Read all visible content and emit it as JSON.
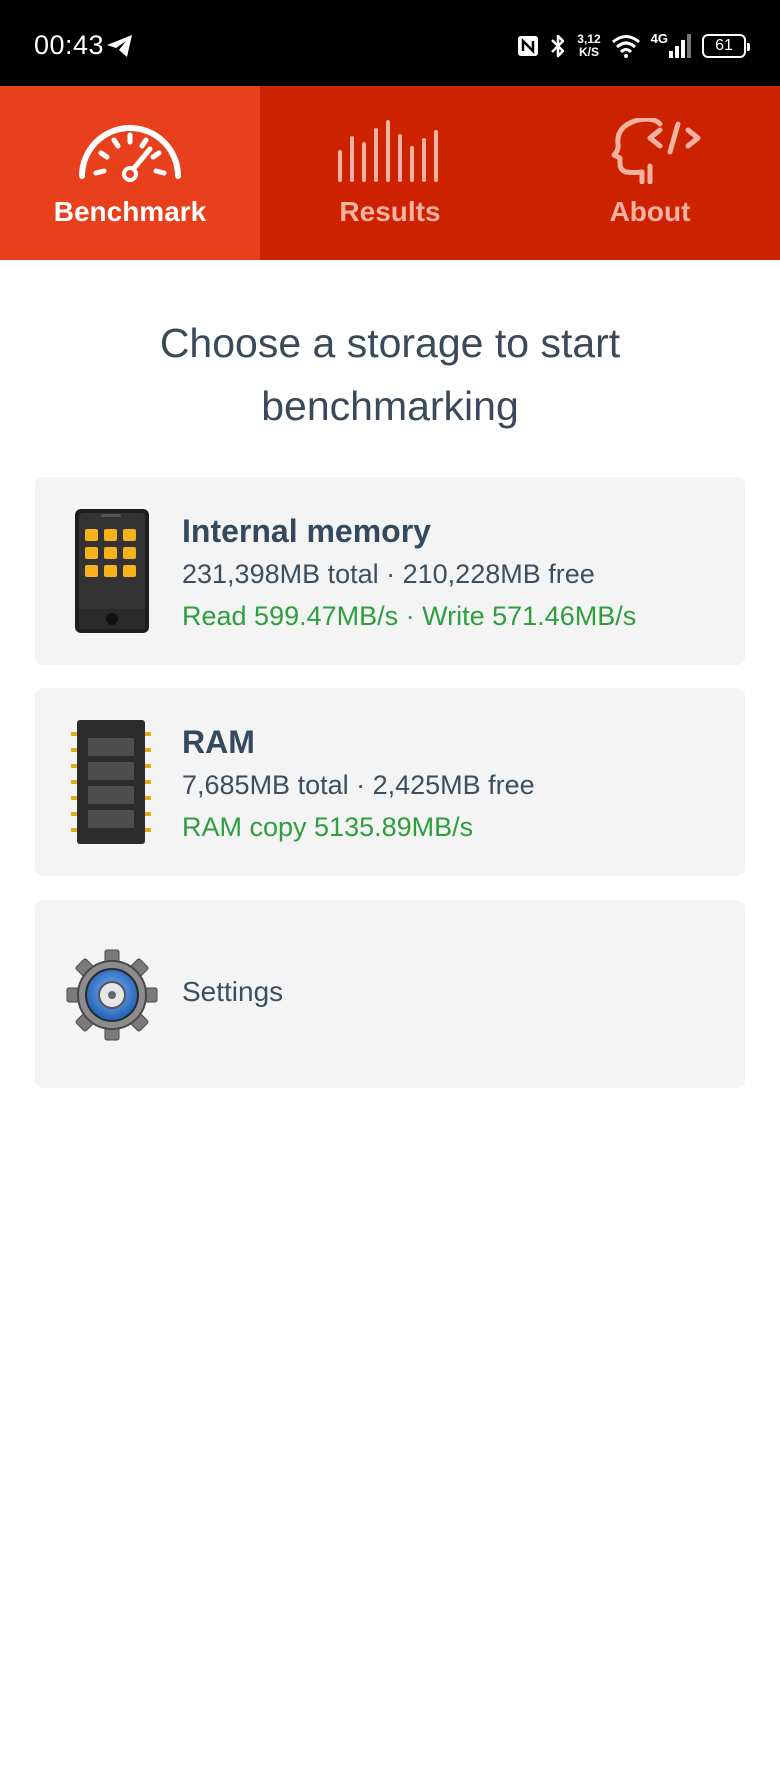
{
  "status_bar": {
    "time": "00:43",
    "speed_value": "3,12",
    "speed_unit": "K/S",
    "network_type": "4G",
    "battery": "61"
  },
  "tabs": [
    {
      "label": "Benchmark",
      "icon": "speedometer-icon",
      "active": true
    },
    {
      "label": "Results",
      "icon": "bars-icon",
      "active": false
    },
    {
      "label": "About",
      "icon": "head-code-icon",
      "active": false
    }
  ],
  "heading": "Choose a storage to start benchmarking",
  "cards": {
    "internal": {
      "title": "Internal memory",
      "sub": "231,398MB total · 210,228MB free",
      "speed": "Read 599.47MB/s · Write 571.46MB/s",
      "icon": "phone-icon"
    },
    "ram": {
      "title": "RAM",
      "sub": "7,685MB total · 2,425MB free",
      "speed": "RAM copy 5135.89MB/s",
      "icon": "ram-chip-icon"
    },
    "settings": {
      "label": "Settings",
      "icon": "gear-icon"
    }
  },
  "colors": {
    "tab_bar": "#cc2200",
    "tab_active": "#e8401c",
    "speed_text": "#2e9e3e",
    "title_text": "#34495e"
  }
}
